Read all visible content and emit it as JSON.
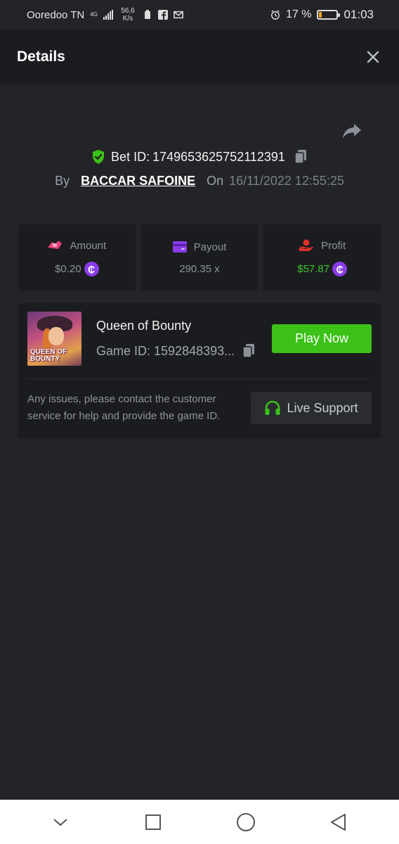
{
  "status_bar": {
    "carrier": "Ooredoo TN",
    "network": "4G",
    "speed": "56,6 K/s",
    "battery_pct": "17 %",
    "battery_level": 0.17,
    "time": "01:03"
  },
  "header": {
    "title": "Details"
  },
  "bet": {
    "label": "Bet ID:",
    "id": "1749653625752112391",
    "by_label": "By",
    "user": "BACCAR SAFOINE",
    "on_label": "On",
    "date": "16/11/2022 12:55:25"
  },
  "stats": [
    {
      "label": "Amount",
      "value": "$0.20",
      "icon": "amount-icon",
      "color": "#e8407a"
    },
    {
      "label": "Payout",
      "value": "290.35 x",
      "icon": "wallet-icon",
      "color": "#8a3ce8"
    },
    {
      "label": "Profit",
      "value": "$57.87",
      "icon": "hand-coin-icon",
      "color": "#e0322c"
    }
  ],
  "game": {
    "name": "Queen of Bounty",
    "thumb_logo_line1": "QUEEN OF",
    "thumb_logo_line2": "BOUNTY",
    "id_text": "Game ID: 1592848393...",
    "play_label": "Play Now",
    "help_text": "Any issues, please contact the customer service for help and provide the game ID.",
    "support_label": "Live Support"
  },
  "colors": {
    "accent_green": "#3bc117",
    "profit_green": "#3ec531",
    "coin_purple": "#8a3ce8",
    "background": "#232428",
    "card": "#1b1c1f"
  }
}
